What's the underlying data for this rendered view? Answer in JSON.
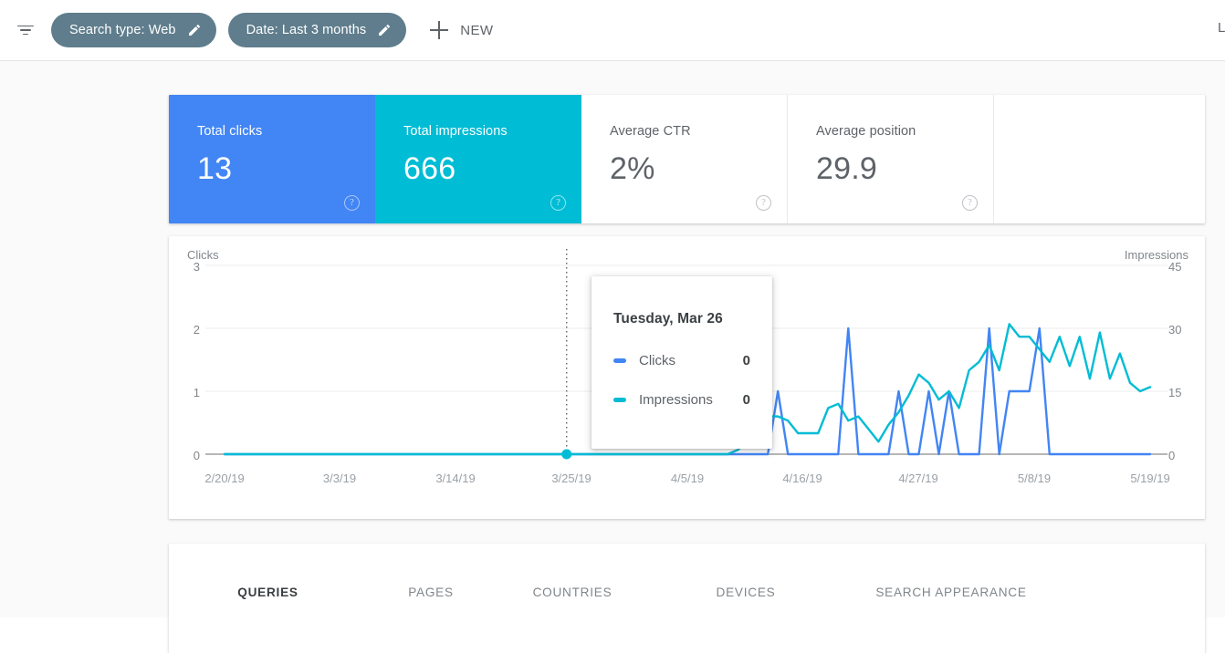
{
  "topbar": {
    "filter_icon": "filter-icon",
    "chips": [
      {
        "label": "Search type: Web",
        "edit_icon": "pencil-icon"
      },
      {
        "label": "Date: Last 3 months",
        "edit_icon": "pencil-icon"
      }
    ],
    "new_button": {
      "label": "NEW",
      "icon": "plus-icon"
    },
    "corner_cutoff_text": "L",
    "chip_color": "#5f7d8c"
  },
  "metrics": [
    {
      "title": "Total clicks",
      "value": "13",
      "state": "active",
      "color": "#4285f4",
      "help": "?"
    },
    {
      "title": "Total impressions",
      "value": "666",
      "state": "active",
      "color": "#00bcd4",
      "help": "?"
    },
    {
      "title": "Average CTR",
      "value": "2%",
      "state": "inactive",
      "color": "#ffffff",
      "help": "?"
    },
    {
      "title": "Average position",
      "value": "29.9",
      "state": "inactive",
      "color": "#ffffff",
      "help": "?"
    }
  ],
  "tooltip": {
    "date": "Tuesday, Mar 26",
    "rows": [
      {
        "label": "Clicks",
        "value": "0",
        "color": "#4285f4"
      },
      {
        "label": "Impressions",
        "value": "0",
        "color": "#00bcd4"
      }
    ]
  },
  "tabs": [
    {
      "label": "QUERIES",
      "active": true
    },
    {
      "label": "PAGES",
      "active": false
    },
    {
      "label": "COUNTRIES",
      "active": false
    },
    {
      "label": "DEVICES",
      "active": false
    },
    {
      "label": "SEARCH APPEARANCE",
      "active": false
    }
  ],
  "chart_data": {
    "type": "line",
    "title": "",
    "xlabel": "",
    "left_axis": {
      "name": "Clicks",
      "ticks": [
        "3",
        "2",
        "1",
        "0"
      ],
      "ylim": [
        0,
        3
      ],
      "color": "#4285f4"
    },
    "right_axis": {
      "name": "Impressions",
      "ticks": [
        "45",
        "30",
        "15",
        "0"
      ],
      "ylim": [
        0,
        45
      ],
      "color": "#00bcd4"
    },
    "xticks": [
      "2/20/19",
      "3/3/19",
      "3/14/19",
      "3/25/19",
      "4/5/19",
      "4/16/19",
      "4/27/19",
      "5/8/19",
      "5/19/19"
    ],
    "grid": true,
    "legend": "tooltip",
    "hover": {
      "date": "Tuesday, Mar 26",
      "x_index": 34,
      "clicks": 0,
      "impressions": 0
    },
    "series": [
      {
        "name": "Clicks",
        "color": "#4285f4",
        "axis": "left",
        "values": [
          0,
          0,
          0,
          0,
          0,
          0,
          0,
          0,
          0,
          0,
          0,
          0,
          0,
          0,
          0,
          0,
          0,
          0,
          0,
          0,
          0,
          0,
          0,
          0,
          0,
          0,
          0,
          0,
          0,
          0,
          0,
          0,
          0,
          0,
          0,
          0,
          0,
          0,
          0,
          0,
          0,
          0,
          0,
          0,
          0,
          0,
          0,
          0,
          0,
          0,
          0,
          0,
          0,
          0,
          0,
          1,
          0,
          0,
          0,
          0,
          0,
          0,
          2,
          0,
          0,
          0,
          0,
          1,
          0,
          0,
          1,
          0,
          1,
          0,
          0,
          0,
          2,
          0,
          1,
          1,
          1,
          2,
          0,
          0,
          0,
          0,
          0,
          0,
          0,
          0,
          0,
          0,
          0
        ]
      },
      {
        "name": "Impressions",
        "color": "#00bcd4",
        "axis": "right",
        "values": [
          0,
          0,
          0,
          0,
          0,
          0,
          0,
          0,
          0,
          0,
          0,
          0,
          0,
          0,
          0,
          0,
          0,
          0,
          0,
          0,
          0,
          0,
          0,
          0,
          0,
          0,
          0,
          0,
          0,
          0,
          0,
          0,
          0,
          0,
          0,
          0,
          0,
          0,
          0,
          0,
          0,
          0,
          0,
          0,
          0,
          0,
          0,
          0,
          0,
          0,
          0,
          1,
          3,
          6,
          9,
          9,
          8,
          5,
          5,
          5,
          11,
          12,
          8,
          9,
          6,
          3,
          7,
          10,
          14,
          19,
          17,
          13,
          15,
          11,
          20,
          22,
          26,
          20,
          31,
          28,
          28,
          25,
          22,
          28,
          21,
          28,
          18,
          29,
          18,
          24,
          17,
          15,
          16
        ]
      }
    ]
  }
}
